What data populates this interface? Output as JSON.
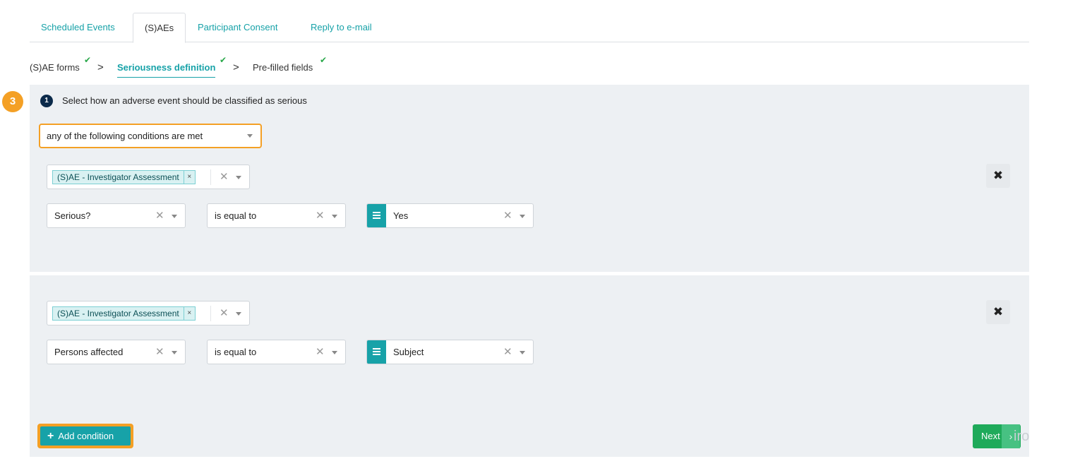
{
  "tabs": [
    {
      "label": "Scheduled Events"
    },
    {
      "label": "(S)AEs"
    },
    {
      "label": "Participant Consent"
    },
    {
      "label": "Reply to e-mail"
    }
  ],
  "breadcrumbs": [
    {
      "label": "(S)AE forms"
    },
    {
      "label": "Seriousness definition"
    },
    {
      "label": "Pre-filled fields"
    }
  ],
  "check_glyph": "✔",
  "sep_glyph": ">",
  "step_badge": "3",
  "instruction": {
    "number": "1",
    "text": "Select how an adverse event should be classified as serious"
  },
  "match_select": {
    "value": "any of the following conditions are met"
  },
  "conditions": [
    {
      "form_tag": "(S)AE - Investigator Assessment",
      "field": "Serious?",
      "operator": "is equal to",
      "value": "Yes"
    },
    {
      "form_tag": "(S)AE - Investigator Assessment",
      "field": "Persons affected",
      "operator": "is equal to",
      "value": "Subject"
    }
  ],
  "glyphs": {
    "tag_remove": "×",
    "clear": "✕",
    "delete": "✖",
    "plus": "+",
    "next_arrow": "›"
  },
  "buttons": {
    "add_condition": "Add condition",
    "next": "Next"
  },
  "watermark": "iro",
  "colors": {
    "accent": "#17a2a8",
    "highlight": "#f4a025",
    "success": "#1faa5a",
    "panel": "#edf0f3"
  }
}
